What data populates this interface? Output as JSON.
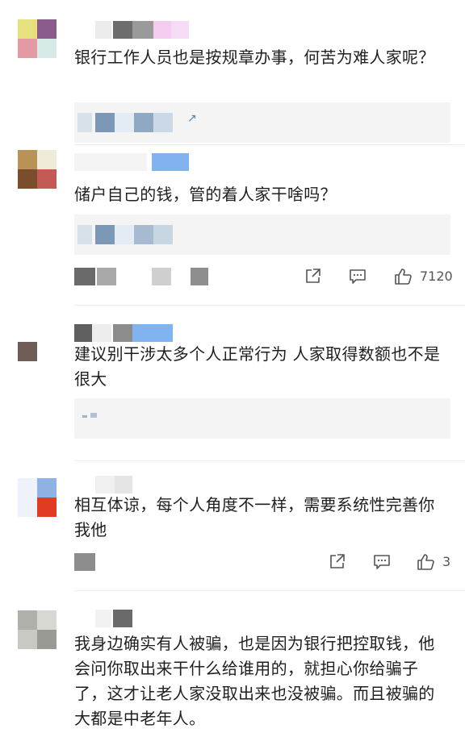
{
  "comments": [
    {
      "text": "银行工作人员也是按规章办事，何苦为难人家呢？"
    },
    {
      "text": "储户自己的钱，管的着人家干啥吗？",
      "likes": "7120"
    },
    {
      "text": "建议别干涉太多个人正常行为  人家取得数额也不是很大"
    },
    {
      "text": "相互体谅，每个人角度不一样，需要系统性完善你我他",
      "likes": "3"
    },
    {
      "text": "我身边确实有人被骗，也是因为银行把控取钱，他会问你取出来干什么给谁用的，就担心你给骗子了，这才让老人家没取出来也没被骗。而且被骗的大都是中老年人。"
    }
  ],
  "icons": {
    "share": "share-icon",
    "reply": "comment-icon",
    "like": "thumbs-up-icon"
  },
  "colors": {
    "text": "#1f1f1f",
    "reply_bg": "#f4f4f4",
    "icon": "#555555"
  }
}
